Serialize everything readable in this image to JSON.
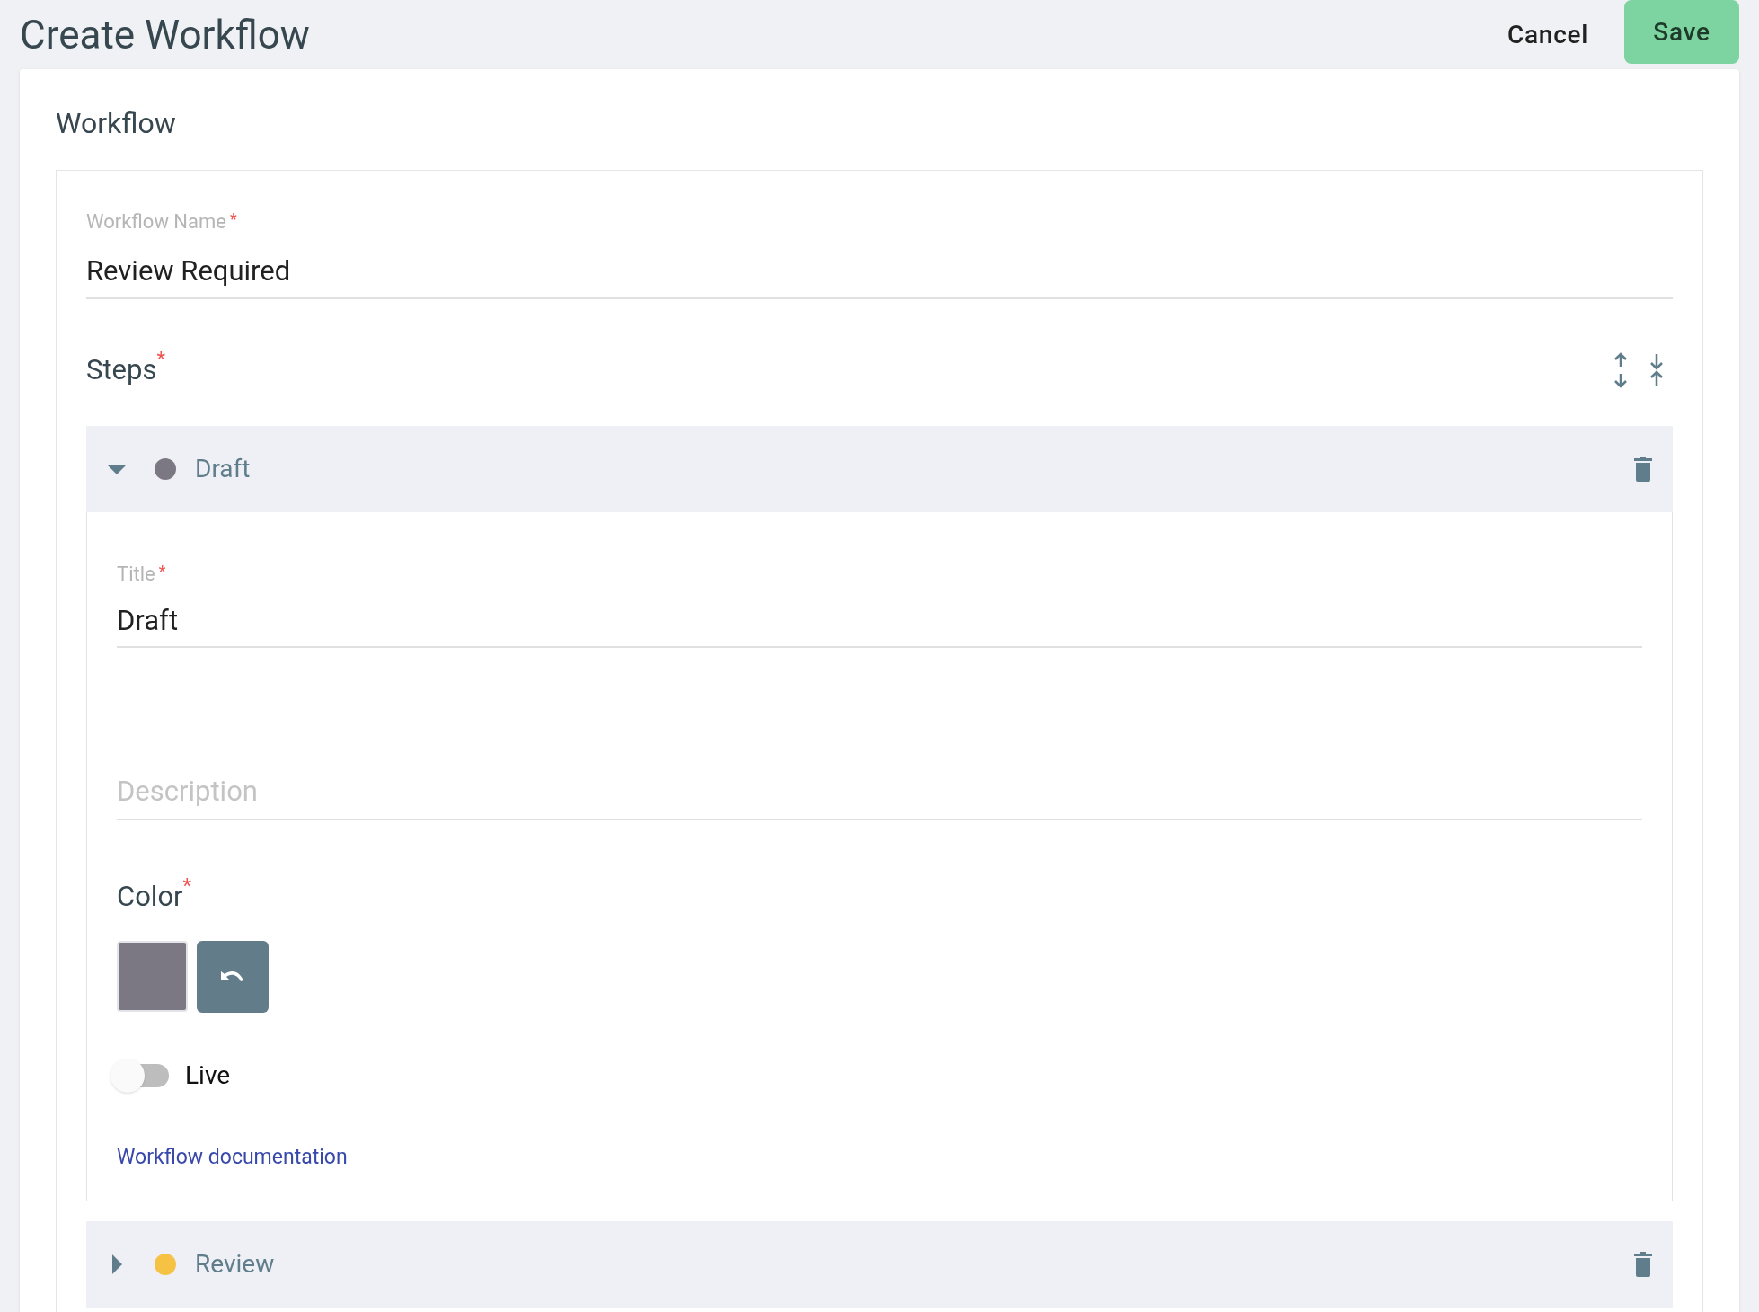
{
  "header": {
    "title": "Create Workflow",
    "cancel": "Cancel",
    "save": "Save"
  },
  "section_title": "Workflow",
  "workflow_name": {
    "label": "Workflow Name",
    "asterisk": "*",
    "value": "Review Required"
  },
  "steps_heading": {
    "label": "Steps",
    "asterisk": "*"
  },
  "steps": [
    {
      "title": "Draft",
      "color": "#7b7883",
      "expanded": true,
      "title_field": {
        "label": "Title",
        "asterisk": "*",
        "value": "Draft"
      },
      "description": {
        "placeholder": "Description"
      },
      "color_field": {
        "label": "Color",
        "asterisk": "*"
      },
      "live": {
        "label": "Live",
        "on": false
      },
      "link": "Workflow documentation"
    },
    {
      "title": "Review",
      "color": "#f6c244",
      "expanded": false
    }
  ]
}
